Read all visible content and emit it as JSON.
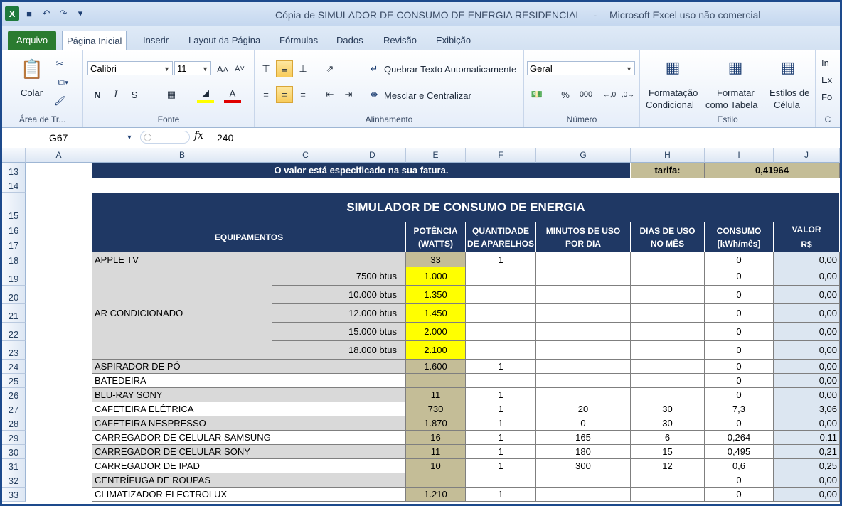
{
  "window": {
    "title_doc": "Cópia de SIMULADOR DE CONSUMO DE ENERGIA RESIDENCIAL",
    "title_sep": "-",
    "title_app": "Microsoft Excel uso não comercial"
  },
  "tabs": {
    "file": "Arquivo",
    "home": "Página Inicial",
    "insert": "Inserir",
    "layout": "Layout da Página",
    "formulas": "Fórmulas",
    "data": "Dados",
    "review": "Revisão",
    "view": "Exibição"
  },
  "ribbon": {
    "clipboard": {
      "paste": "Colar",
      "group": "Área de Tr..."
    },
    "font": {
      "name": "Calibri",
      "size": "11",
      "bold": "N",
      "italic": "I",
      "underline": "S",
      "group": "Fonte"
    },
    "alignment": {
      "wrap": "Quebrar Texto Automaticamente",
      "merge": "Mesclar e Centralizar",
      "group": "Alinhamento"
    },
    "number": {
      "format": "Geral",
      "percent": "%",
      "thousands": "000",
      "group": "Número"
    },
    "styles": {
      "cond1": "Formatação",
      "cond2": "Condicional",
      "table1": "Formatar",
      "table2": "como Tabela",
      "cell1": "Estilos de",
      "cell2": "Célula",
      "group": "Estilo"
    },
    "cells": {
      "insert": "In",
      "delete": "Ex",
      "format": "Fo",
      "group": "C"
    }
  },
  "formula_bar": {
    "name_box": "G67",
    "fx": "fx",
    "value": "240"
  },
  "columns": [
    "A",
    "B",
    "C",
    "D",
    "E",
    "F",
    "G",
    "H",
    "I",
    "J"
  ],
  "sheet": {
    "info_text": "O valor está especificado na sua fatura.",
    "tarifa_label": "tarifa:",
    "tarifa_value": "0,41964",
    "title": "SIMULADOR DE CONSUMO DE ENERGIA",
    "headers": {
      "equip": "EQUIPAMENTOS",
      "pot1": "POTÊNCIA",
      "pot2": "(WATTS)",
      "qtd1": "QUANTIDADE",
      "qtd2": "DE APARELHOS",
      "min1": "MINUTOS DE USO",
      "min2": "POR DIA",
      "dias1": "DIAS DE USO",
      "dias2": "NO MÊS",
      "cons1": "CONSUMO",
      "cons2": "[kWh/mês]",
      "val1": "VALOR",
      "val2": "R$"
    },
    "ar_label": "AR CONDICIONADO",
    "rows": [
      {
        "row": "13"
      },
      {
        "row": "14"
      },
      {
        "row": "15"
      },
      {
        "row": "16"
      },
      {
        "row": "17"
      },
      {
        "row": "18",
        "name": "APPLE TV",
        "sub": "",
        "pot": "33",
        "qtd": "1",
        "min": "",
        "dias": "",
        "cons": "0",
        "val": "0,00"
      },
      {
        "row": "19",
        "name": "",
        "sub": "7500 btus",
        "pot": "1.000",
        "qtd": "",
        "min": "",
        "dias": "",
        "cons": "0",
        "val": "0,00"
      },
      {
        "row": "20",
        "name": "",
        "sub": "10.000 btus",
        "pot": "1.350",
        "qtd": "",
        "min": "",
        "dias": "",
        "cons": "0",
        "val": "0,00"
      },
      {
        "row": "21",
        "name": "",
        "sub": "12.000 btus",
        "pot": "1.450",
        "qtd": "",
        "min": "",
        "dias": "",
        "cons": "0",
        "val": "0,00"
      },
      {
        "row": "22",
        "name": "",
        "sub": "15.000 btus",
        "pot": "2.000",
        "qtd": "",
        "min": "",
        "dias": "",
        "cons": "0",
        "val": "0,00"
      },
      {
        "row": "23",
        "name": "",
        "sub": "18.000 btus",
        "pot": "2.100",
        "qtd": "",
        "min": "",
        "dias": "",
        "cons": "0",
        "val": "0,00"
      },
      {
        "row": "24",
        "name": "ASPIRADOR DE PÓ",
        "sub": "",
        "pot": "1.600",
        "qtd": "1",
        "min": "",
        "dias": "",
        "cons": "0",
        "val": "0,00"
      },
      {
        "row": "25",
        "name": "BATEDEIRA",
        "sub": "",
        "pot": "",
        "qtd": "",
        "min": "",
        "dias": "",
        "cons": "0",
        "val": "0,00"
      },
      {
        "row": "26",
        "name": "BLU-RAY SONY",
        "sub": "",
        "pot": "11",
        "qtd": "1",
        "min": "",
        "dias": "",
        "cons": "0",
        "val": "0,00"
      },
      {
        "row": "27",
        "name": "CAFETEIRA ELÉTRICA",
        "sub": "",
        "pot": "730",
        "qtd": "1",
        "min": "20",
        "dias": "30",
        "cons": "7,3",
        "val": "3,06"
      },
      {
        "row": "28",
        "name": "CAFETEIRA NESPRESSO",
        "sub": "",
        "pot": "1.870",
        "qtd": "1",
        "min": "0",
        "dias": "30",
        "cons": "0",
        "val": "0,00"
      },
      {
        "row": "29",
        "name": "CARREGADOR DE CELULAR SAMSUNG",
        "sub": "",
        "pot": "16",
        "qtd": "1",
        "min": "165",
        "dias": "6",
        "cons": "0,264",
        "val": "0,11"
      },
      {
        "row": "30",
        "name": "CARREGADOR DE CELULAR SONY",
        "sub": "",
        "pot": "11",
        "qtd": "1",
        "min": "180",
        "dias": "15",
        "cons": "0,495",
        "val": "0,21"
      },
      {
        "row": "31",
        "name": "CARREGADOR DE IPAD",
        "sub": "",
        "pot": "10",
        "qtd": "1",
        "min": "300",
        "dias": "12",
        "cons": "0,6",
        "val": "0,25"
      },
      {
        "row": "32",
        "name": "CENTRÍFUGA DE ROUPAS",
        "sub": "",
        "pot": "",
        "qtd": "",
        "min": "",
        "dias": "",
        "cons": "0",
        "val": "0,00"
      },
      {
        "row": "33",
        "name": "CLIMATIZADOR ELECTROLUX",
        "sub": "",
        "pot": "1.210",
        "qtd": "1",
        "min": "",
        "dias": "",
        "cons": "0",
        "val": "0,00"
      }
    ]
  }
}
